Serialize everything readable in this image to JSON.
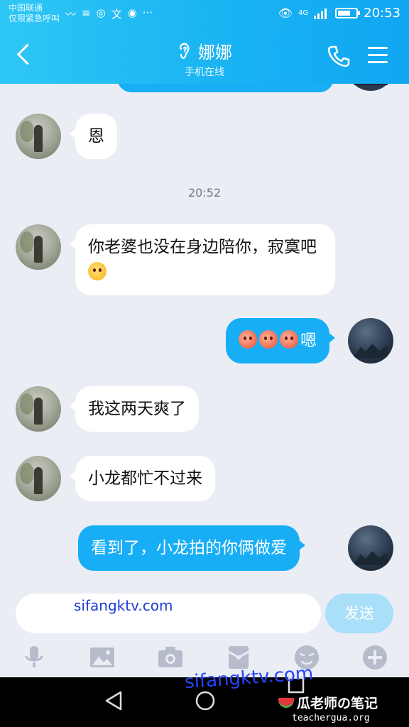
{
  "status_bar": {
    "carrier_line1": "中国联通",
    "carrier_line2": "仅限紧急呼叫",
    "icons_left": [
      "activity-icon",
      "signal-flag-icon",
      "app-icon",
      "translate-icon",
      "location-icon",
      "more-icon"
    ],
    "icons_left_glyphs": [
      "〰",
      "≡",
      "◎",
      "文",
      "◉",
      "···"
    ],
    "eye_glyph": "👁",
    "network_label": "4G",
    "battery_level_percent": 70,
    "time": "20:53"
  },
  "header": {
    "title": "娜娜",
    "subtitle": "手机在线",
    "ear_glyph": "ʔ"
  },
  "chat": {
    "timestamp": "20:52",
    "messages": [
      {
        "side": "in",
        "text": "恩"
      },
      {
        "side": "in",
        "text": "你老婆也没在身边陪你，寂寞吧",
        "emoji": "yawn-emoji"
      },
      {
        "side": "out",
        "text": "嗯",
        "emoji_count": 3,
        "emoji": "blush-emoji"
      },
      {
        "side": "in",
        "text": "我这两天爽了"
      },
      {
        "side": "in",
        "text": "小龙都忙不过来"
      },
      {
        "side": "out",
        "text": "看到了，小龙拍的你俩做爱"
      }
    ]
  },
  "input": {
    "value": "sifangktv.com",
    "send_label": "发送"
  },
  "toolbar": {
    "tools": [
      "microphone-icon",
      "image-icon",
      "camera-icon",
      "red-packet-icon",
      "emoji-icon",
      "plus-icon"
    ]
  },
  "watermark": {
    "text": "sifangktv.com",
    "brand": "瓜老师の笔记",
    "brand_url": "teachergua.org"
  },
  "colors": {
    "header": "#19b3f3",
    "bubble_out": "#18aef6",
    "bubble_in": "#ffffff",
    "background": "#ebedf5",
    "send_button": "#a9dff8"
  }
}
